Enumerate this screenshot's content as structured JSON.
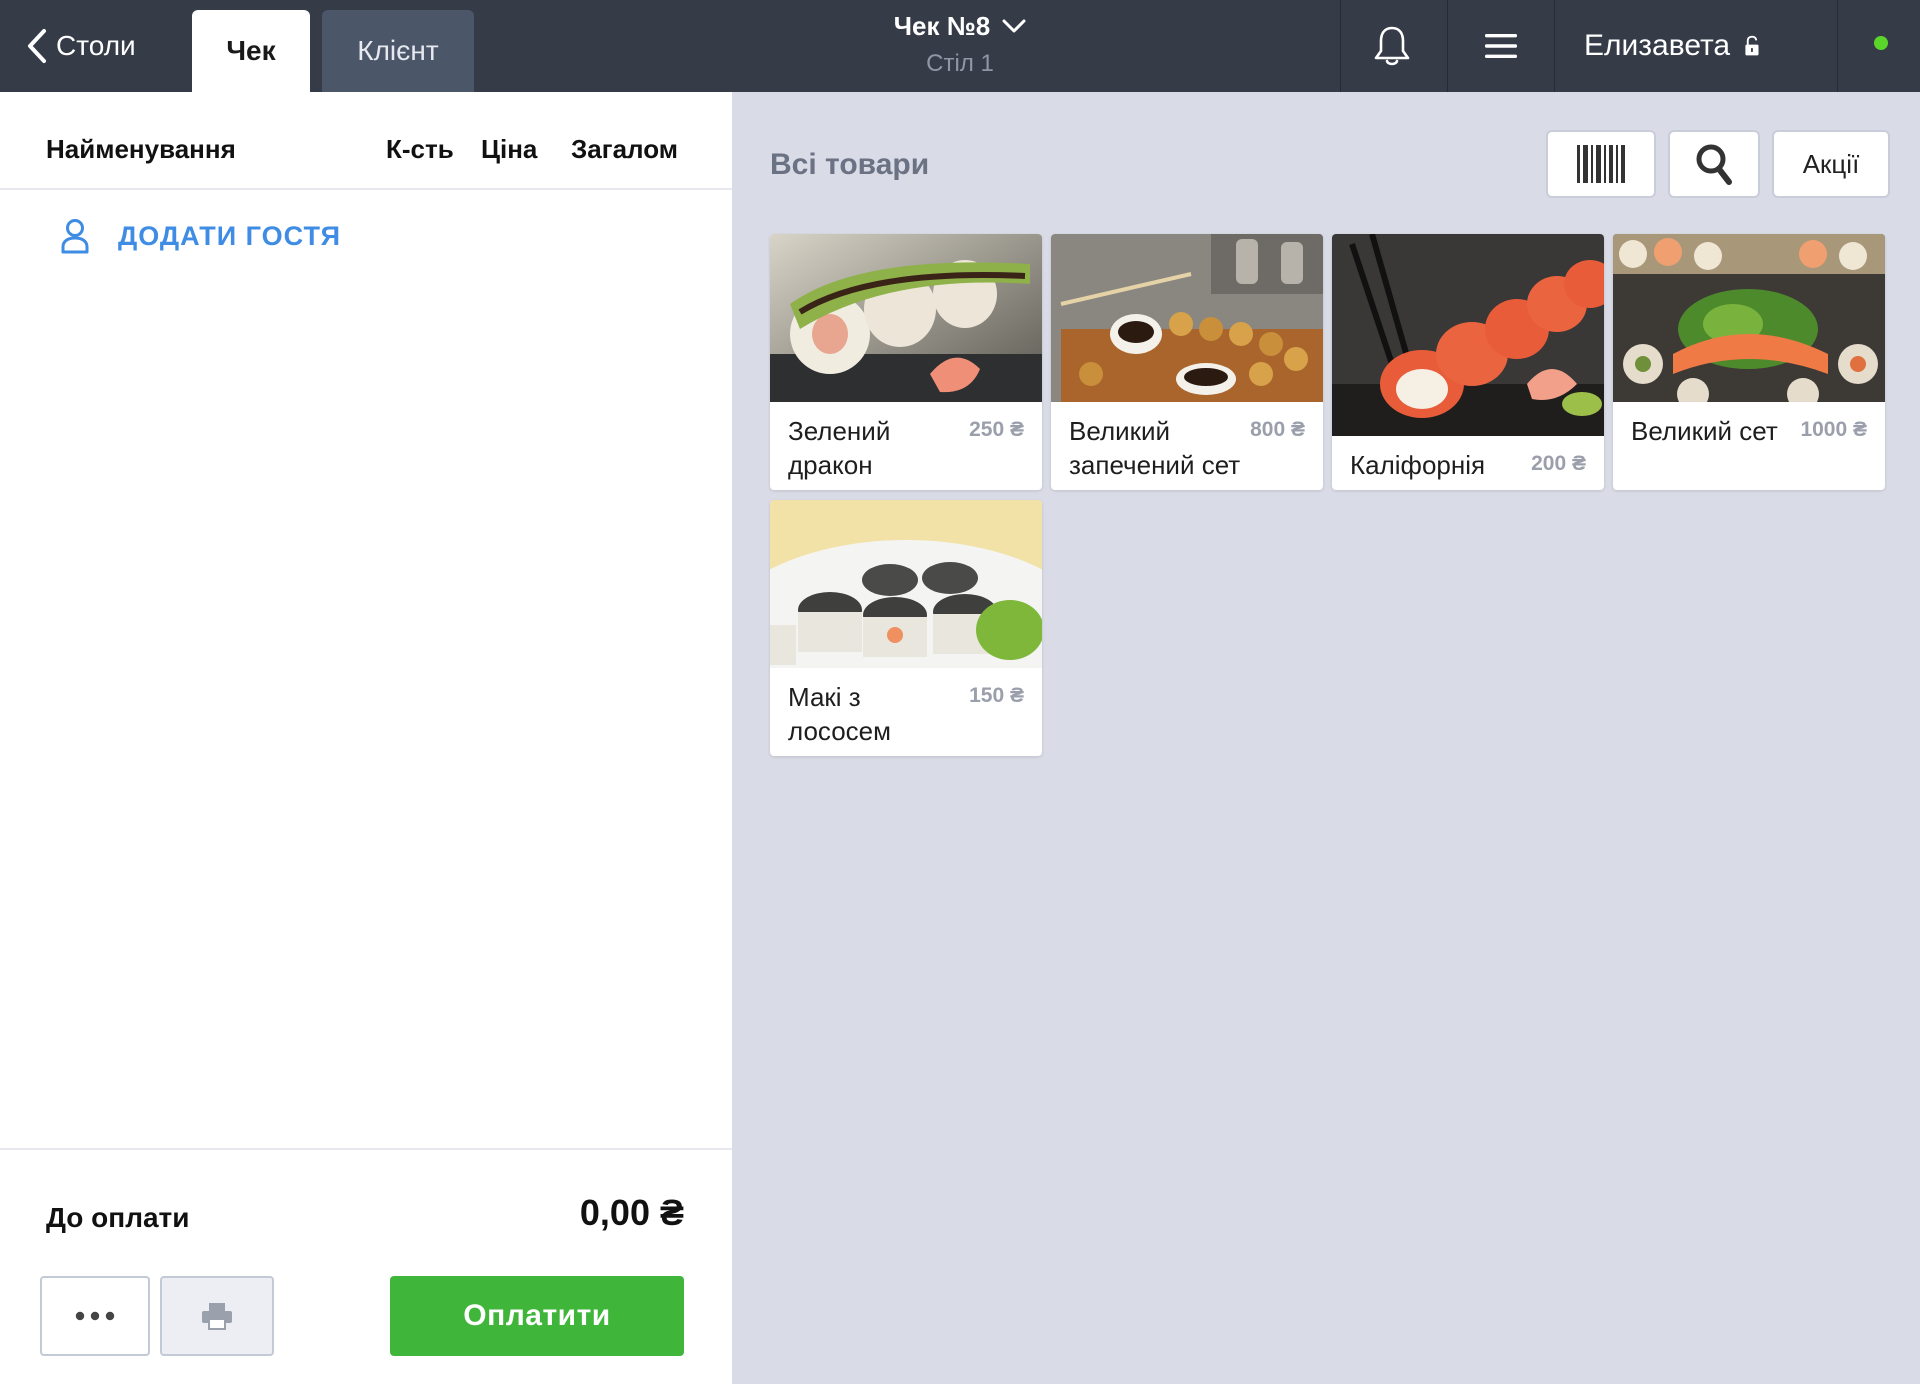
{
  "topbar": {
    "back_label": "Столи",
    "tabs": [
      {
        "label": "Чек"
      },
      {
        "label": "Клієнт"
      }
    ],
    "check_title": "Чек №8",
    "table_label": "Стіл 1",
    "user_name": "Елизавета",
    "status_color": "#5ad62a"
  },
  "order": {
    "columns": {
      "name": "Найменування",
      "qty": "К-сть",
      "price": "Ціна",
      "total": "Загалом"
    },
    "add_guest_label": "ДОДАТИ ГОСТЯ",
    "due_label": "До оплати",
    "due_amount": "0,00 ₴",
    "pay_label": "Оплатити"
  },
  "catalog": {
    "title": "Всі товари",
    "promo_label": "Акції",
    "products": [
      {
        "name": "Зелений дракон",
        "price": "250 ₴"
      },
      {
        "name": "Великий запечений сет",
        "price": "800 ₴"
      },
      {
        "name": "Каліфорнія",
        "price": "200 ₴"
      },
      {
        "name": "Великий сет",
        "price": "1000 ₴"
      },
      {
        "name": "Макі з лососем",
        "price": "150 ₴"
      }
    ]
  },
  "colors": {
    "topbar": "#353c48",
    "accent_blue": "#3e8ce3",
    "pay_green": "#3fb53a",
    "catalog_bg": "#d9dbe6"
  },
  "icons": [
    "chevron-left-icon",
    "chevron-down-icon",
    "bell-icon",
    "hamburger-menu-icon",
    "unlocked-padlock-icon",
    "user-icon",
    "ellipsis-icon",
    "printer-icon",
    "barcode-icon",
    "search-icon"
  ]
}
